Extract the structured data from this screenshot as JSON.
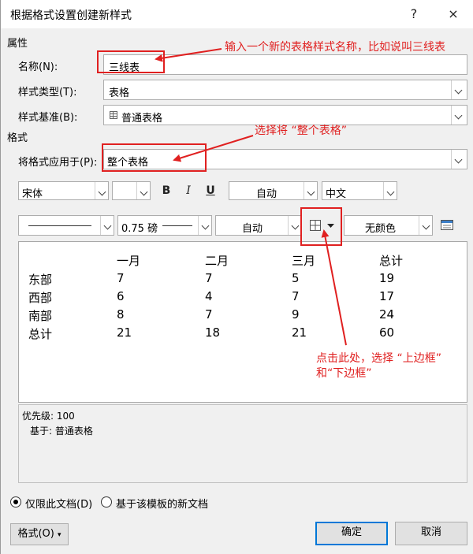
{
  "window": {
    "title": "根据格式设置创建新样式",
    "help_icon": "?",
    "close_icon": "×"
  },
  "properties": {
    "section_label": "属性",
    "name_label": "名称(N):",
    "name_value": "三线表",
    "type_label": "样式类型(T):",
    "type_value": "表格",
    "based_label": "样式基准(B):",
    "based_value": "普通表格"
  },
  "format": {
    "section_label": "格式",
    "apply_label": "将格式应用于(P):",
    "apply_value": "整个表格"
  },
  "toolbar1": {
    "font": "宋体",
    "size": "",
    "bold": "B",
    "italic": "I",
    "underline": "U",
    "color": "自动",
    "script": "中文"
  },
  "toolbar2": {
    "line_width": "0.75 磅",
    "border_color": "自动",
    "shading": "无颜色"
  },
  "preview": {
    "headers": [
      "",
      "一月",
      "二月",
      "三月",
      "总计"
    ],
    "rows": [
      [
        "东部",
        "7",
        "7",
        "5",
        "19"
      ],
      [
        "西部",
        "6",
        "4",
        "7",
        "17"
      ],
      [
        "南部",
        "8",
        "7",
        "9",
        "24"
      ],
      [
        "总计",
        "21",
        "18",
        "21",
        "60"
      ]
    ]
  },
  "description": {
    "line1": "优先级: 100",
    "line2": "基于: 普通表格"
  },
  "options": {
    "only_doc": "仅限此文档(D)",
    "new_docs": "基于该模板的新文档",
    "selected": "only_doc"
  },
  "buttons": {
    "format": "格式(O)",
    "ok": "确定",
    "cancel": "取消"
  },
  "annotations": {
    "name_note": "输入一个新的表格样式名称，比如说叫三线表",
    "apply_note": "选择将 “整个表格”",
    "border_note_1": "点击此处，选择 “上边框”",
    "border_note_2": "和“下边框”"
  },
  "colors": {
    "annotation": "#e02020",
    "default_button_border": "#0078d7"
  }
}
